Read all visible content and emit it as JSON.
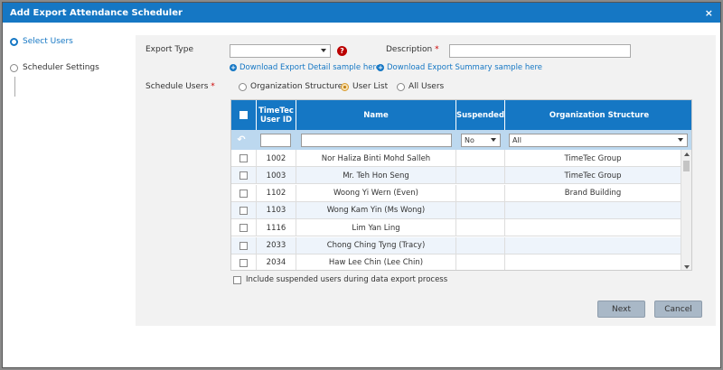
{
  "dialog": {
    "title": "Add Export Attendance Scheduler",
    "close": "×"
  },
  "steps": [
    {
      "label": "Select Users",
      "active": true
    },
    {
      "label": "Scheduler Settings",
      "active": false
    }
  ],
  "form": {
    "export_type_label": "Export Type",
    "export_type_value": "",
    "description_label": "Description",
    "required_mark": "*",
    "description_value": "",
    "help_icon": "?",
    "link_detail": "Download Export Detail sample here",
    "link_summary": "Download Export Summary sample here",
    "link_icon": "+",
    "schedule_users_label": "Schedule Users",
    "schedule_options": [
      {
        "label": "Organization Structure",
        "checked": false
      },
      {
        "label": "User List",
        "checked": true
      },
      {
        "label": "All Users",
        "checked": false
      }
    ]
  },
  "grid": {
    "headers": {
      "userid": "TimeTec User ID",
      "name": "Name",
      "suspended": "Suspended",
      "org": "Organization Structure"
    },
    "filter": {
      "undo_icon": "↶",
      "suspended": "No",
      "org": "All"
    },
    "rows": [
      {
        "id": "1002",
        "name": "Nor Haliza Binti Mohd Salleh",
        "suspended": "",
        "org": "TimeTec Group"
      },
      {
        "id": "1003",
        "name": "Mr. Teh Hon Seng",
        "suspended": "",
        "org": "TimeTec Group"
      },
      {
        "id": "1102",
        "name": "Woong Yi Wern (Even)",
        "suspended": "",
        "org": "Brand Building"
      },
      {
        "id": "1103",
        "name": "Wong Kam Yin (Ms Wong)",
        "suspended": "",
        "org": ""
      },
      {
        "id": "1116",
        "name": "Lim Yan Ling",
        "suspended": "",
        "org": ""
      },
      {
        "id": "2033",
        "name": "Chong Ching Tyng (Tracy)",
        "suspended": "",
        "org": ""
      },
      {
        "id": "2034",
        "name": "Haw Lee Chin (Lee Chin)",
        "suspended": "",
        "org": ""
      }
    ]
  },
  "include_suspended_label": "Include suspended users during data export process",
  "buttons": {
    "next": "Next",
    "cancel": "Cancel"
  },
  "colors": {
    "accent": "#1577c4",
    "filter_bg": "#bcd8ef",
    "button": "#a9b8c7"
  }
}
